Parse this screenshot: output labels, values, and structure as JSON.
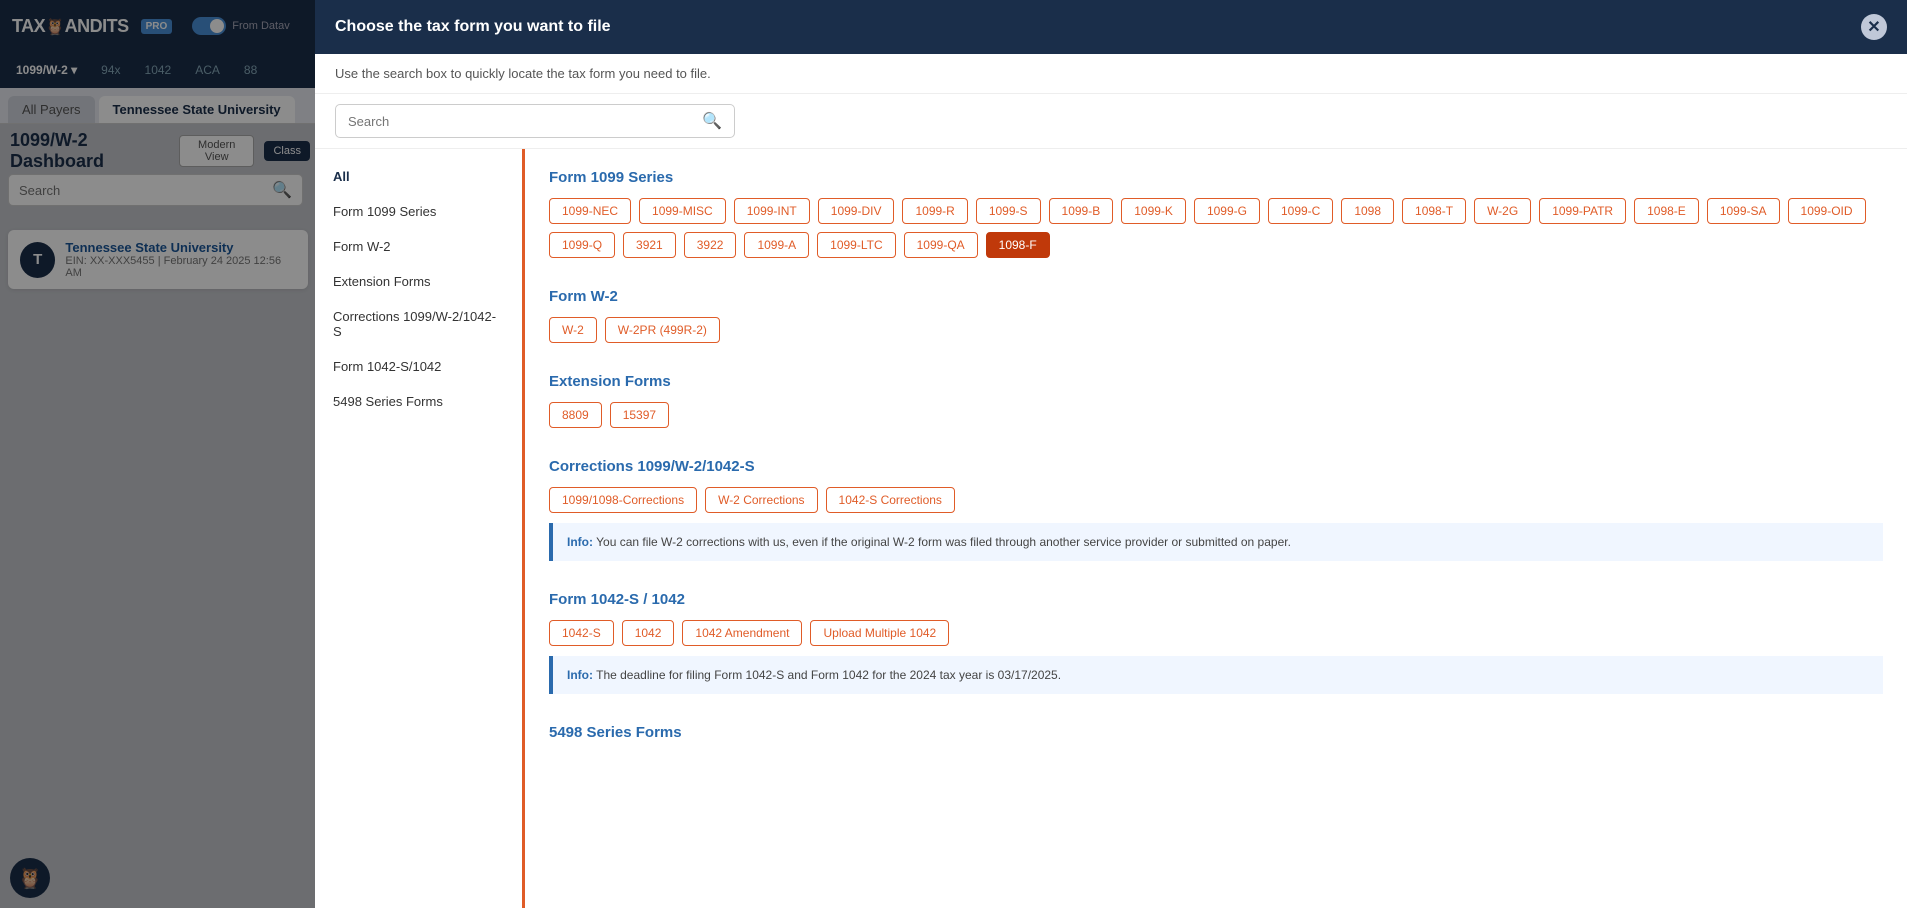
{
  "app": {
    "title": "TaxBandits",
    "pro_badge": "PRO",
    "toggle_label": "From Datav",
    "owl_emoji": "🦉",
    "close_icon": "✕"
  },
  "top_nav": {
    "items": [
      {
        "label": "1099/W-2 ▾",
        "active": true
      },
      {
        "label": "94x",
        "active": false
      },
      {
        "label": "1042",
        "active": false
      },
      {
        "label": "ACA",
        "active": false
      },
      {
        "label": "88",
        "active": false
      }
    ]
  },
  "tabs": [
    {
      "label": "All Payers",
      "active": false
    },
    {
      "label": "Tennessee State University",
      "active": true
    }
  ],
  "dashboard": {
    "title": "1099/W-2 Dashboard",
    "views": [
      {
        "label": "Modern View",
        "active": false
      },
      {
        "label": "Class",
        "active": true
      }
    ],
    "search_placeholder": "Search"
  },
  "payer": {
    "avatar": "T",
    "name": "Tennessee State University",
    "ein": "EIN: XX-XXX5455",
    "date": "February 24 2025 12:56 AM"
  },
  "modal": {
    "title": "Choose the tax form you want to file",
    "subtitle": "Use the search box to quickly locate the tax form you need to file.",
    "search_placeholder": "Search",
    "sidebar_items": [
      {
        "label": "All",
        "active": true
      },
      {
        "label": "Form 1099 Series",
        "active": false
      },
      {
        "label": "Form W-2",
        "active": false
      },
      {
        "label": "Extension Forms",
        "active": false
      },
      {
        "label": "Corrections 1099/W-2/1042-S",
        "active": false
      },
      {
        "label": "Form 1042-S/1042",
        "active": false
      },
      {
        "label": "5498 Series Forms",
        "active": false
      }
    ],
    "sections": [
      {
        "id": "form1099",
        "title": "Form 1099 Series",
        "tags": [
          {
            "label": "1099-NEC",
            "selected": false
          },
          {
            "label": "1099-MISC",
            "selected": false
          },
          {
            "label": "1099-INT",
            "selected": false
          },
          {
            "label": "1099-DIV",
            "selected": false
          },
          {
            "label": "1099-R",
            "selected": false
          },
          {
            "label": "1099-S",
            "selected": false
          },
          {
            "label": "1099-B",
            "selected": false
          },
          {
            "label": "1099-K",
            "selected": false
          },
          {
            "label": "1099-G",
            "selected": false
          },
          {
            "label": "1099-C",
            "selected": false
          },
          {
            "label": "1098",
            "selected": false
          },
          {
            "label": "1098-T",
            "selected": false
          },
          {
            "label": "W-2G",
            "selected": false
          },
          {
            "label": "1099-PATR",
            "selected": false
          },
          {
            "label": "1098-E",
            "selected": false
          },
          {
            "label": "1099-SA",
            "selected": false
          },
          {
            "label": "1099-OID",
            "selected": false
          },
          {
            "label": "1099-Q",
            "selected": false
          },
          {
            "label": "3921",
            "selected": false
          },
          {
            "label": "3922",
            "selected": false
          },
          {
            "label": "1099-A",
            "selected": false
          },
          {
            "label": "1099-LTC",
            "selected": false
          },
          {
            "label": "1099-QA",
            "selected": false
          },
          {
            "label": "1098-F",
            "selected": true
          }
        ]
      },
      {
        "id": "formW2",
        "title": "Form W-2",
        "tags": [
          {
            "label": "W-2",
            "selected": false
          },
          {
            "label": "W-2PR (499R-2)",
            "selected": false
          }
        ]
      },
      {
        "id": "extensionForms",
        "title": "Extension Forms",
        "tags": [
          {
            "label": "8809",
            "selected": false
          },
          {
            "label": "15397",
            "selected": false
          }
        ]
      },
      {
        "id": "corrections",
        "title": "Corrections 1099/W-2/1042-S",
        "tags": [
          {
            "label": "1099/1098-Corrections",
            "selected": false
          },
          {
            "label": "W-2 Corrections",
            "selected": false
          },
          {
            "label": "1042-S Corrections",
            "selected": false
          }
        ],
        "info": "You can file W-2 corrections with us, even if the original W-2 form was filed through another service provider or submitted on paper."
      },
      {
        "id": "form1042",
        "title": "Form 1042-S / 1042",
        "tags": [
          {
            "label": "1042-S",
            "selected": false
          },
          {
            "label": "1042",
            "selected": false
          },
          {
            "label": "1042 Amendment",
            "selected": false
          },
          {
            "label": "Upload Multiple 1042",
            "selected": false
          }
        ],
        "info": "The deadline for filing Form 1042-S and Form 1042 for the 2024 tax year is 03/17/2025."
      },
      {
        "id": "form5498",
        "title": "5498 Series Forms",
        "tags": []
      }
    ]
  }
}
